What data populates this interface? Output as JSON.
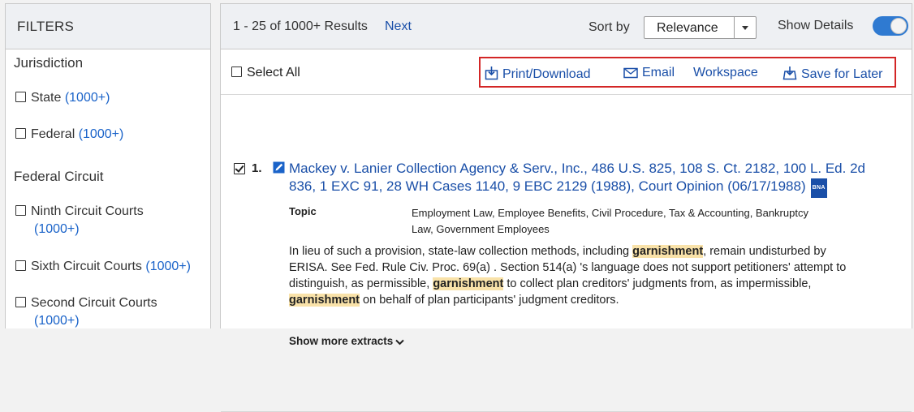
{
  "sidebar": {
    "header": "FILTERS",
    "groups": [
      {
        "title": "Jurisdiction"
      },
      {
        "title": "Federal Circuit"
      }
    ],
    "items": [
      {
        "label": "State",
        "count": "(1000+)"
      },
      {
        "label": "Federal",
        "count": "(1000+)"
      },
      {
        "label": "Ninth Circuit Courts",
        "count": "(1000+)"
      },
      {
        "label": "Sixth Circuit Courts",
        "count": "(1000+)"
      },
      {
        "label": "Second Circuit Courts",
        "count": "(1000+)"
      }
    ]
  },
  "topbar": {
    "results": "1 - 25 of 1000+ Results",
    "next": "Next",
    "sort_label": "Sort by",
    "sort_value": "Relevance",
    "details_label": "Show Details",
    "details_on": true
  },
  "actionbar": {
    "select_all": "Select All",
    "print": "Print/Download",
    "email": "Email",
    "workspace": "Workspace",
    "save": "Save for Later"
  },
  "result": {
    "number": "1.",
    "title": "Mackey v. Lanier Collection Agency & Serv., Inc., 486 U.S. 825, 108 S. Ct. 2182, 100 L. Ed. 2d 836, 1 EXC 91, 28 WH Cases 1140, 9 EBC 2129 (1988), Court Opinion (06/17/1988)",
    "badge": "BNA",
    "topic_label": "Topic",
    "topic_value": "Employment Law, Employee Benefits, Civil Procedure, Tax & Accounting, Bankruptcy Law, Government Employees",
    "extract": {
      "p1": "In lieu of such a provision, state-law collection methods, including ",
      "h1": "garnishment",
      "p2": ", remain undisturbed by ERISA. See Fed. Rule Civ. Proc. 69(a) . Section 514(a) 's language does not support petitioners' attempt to distinguish, as permissible, ",
      "h2": "garnishment",
      "p3": " to collect plan creditors' judgments from, as impermissible, ",
      "h3": "garnishment",
      "p4": " on behalf of plan participants' judgment creditors."
    },
    "show_more": "Show more extracts"
  },
  "colors": {
    "link": "#1a4fa8",
    "highlight": "#f9e2a9",
    "toggle": "#2f7ad1",
    "box": "#d32626"
  }
}
